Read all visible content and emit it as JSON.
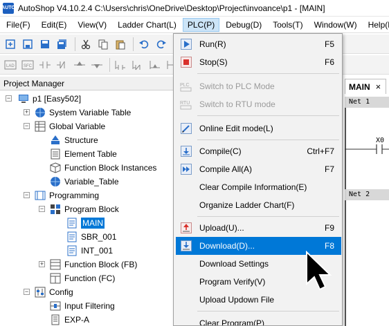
{
  "window": {
    "title": "AutoShop V4.10.2.4  C:\\Users\\chris\\OneDrive\\Desktop\\Project\\invoance\\p1 - [MAIN]",
    "logo_text": "AUTO"
  },
  "menubar": [
    "File(F)",
    "Edit(E)",
    "View(V)",
    "Ladder Chart(L)",
    "PLC(P)",
    "Debug(D)",
    "Tools(T)",
    "Window(W)",
    "Help(H)"
  ],
  "project_manager": {
    "title": "Project Manager"
  },
  "tree": {
    "root": "p1 [Easy502]",
    "system_variable_table": "System Variable Table",
    "global_variable": "Global Variable",
    "structure": "Structure",
    "element_table": "Element Table",
    "fb_instances": "Function Block Instances",
    "variable_table": "Variable_Table",
    "programming": "Programming",
    "program_block": "Program Block",
    "main": "MAIN",
    "sbr": "SBR_001",
    "int": "INT_001",
    "function_block": "Function Block (FB)",
    "function": "Function (FC)",
    "config": "Config",
    "input_filtering": "Input Filtering",
    "expa": "EXP-A"
  },
  "editor": {
    "tab_label": "MAIN",
    "tab_close": "×",
    "net1": "Net 1",
    "net2": "Net 2",
    "contact": "X0"
  },
  "plc_menu": [
    {
      "label": "Run(R)",
      "shortcut": "F5",
      "icon": "run-icon"
    },
    {
      "label": "Stop(S)",
      "shortcut": "F6",
      "icon": "stop-icon"
    },
    {
      "label": "Switch to PLC Mode",
      "shortcut": "",
      "icon": "plc-mode-icon",
      "disabled": true
    },
    {
      "label": "Switch to RTU mode",
      "shortcut": "",
      "icon": "rtu-mode-icon",
      "disabled": true
    },
    {
      "label": "Online Edit mode(L)",
      "shortcut": "",
      "icon": "online-edit-icon"
    },
    {
      "label": "Compile(C)",
      "shortcut": "Ctrl+F7",
      "icon": "compile-icon"
    },
    {
      "label": "Compile All(A)",
      "shortcut": "F7",
      "icon": "compile-all-icon"
    },
    {
      "label": "Clear Compile Information(E)",
      "shortcut": "",
      "icon": ""
    },
    {
      "label": "Organize Ladder Chart(F)",
      "shortcut": "",
      "icon": ""
    },
    {
      "label": "Upload(U)...",
      "shortcut": "F9",
      "icon": "upload-icon"
    },
    {
      "label": "Download(D)...",
      "shortcut": "F8",
      "icon": "download-icon",
      "hover": true
    },
    {
      "label": "Download Settings",
      "shortcut": "",
      "icon": ""
    },
    {
      "label": "Program Verify(V)",
      "shortcut": "",
      "icon": ""
    },
    {
      "label": "Upload Updown File",
      "shortcut": "",
      "icon": ""
    },
    {
      "label": "Clear Program(P)",
      "shortcut": "",
      "icon": ""
    }
  ],
  "colors": {
    "accent": "#0078d7",
    "menu_bg": "#f2f2f2",
    "run_green": "#2a9d3c",
    "stop_red": "#d9302b"
  }
}
